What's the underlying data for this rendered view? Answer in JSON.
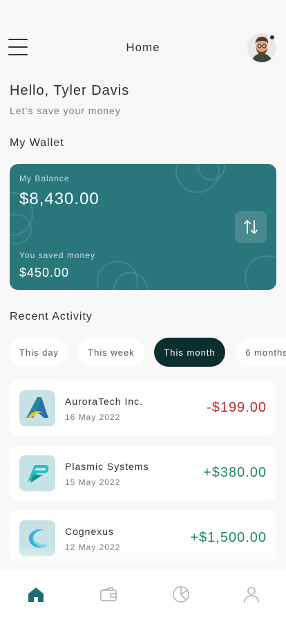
{
  "header": {
    "title": "Home",
    "menu_icon": "hamburger-menu-icon",
    "avatar_icon": "user-avatar"
  },
  "greeting": {
    "title": "Hello, Tyler Davis",
    "subtitle": "Let’s save your money"
  },
  "wallet": {
    "section_title": "My Wallet",
    "balance_label": "My Balance",
    "balance_value": "$8,430.00",
    "saved_label": "You saved money",
    "saved_value": "$450.00",
    "swap_icon": "swap-arrows-icon",
    "card_color": "#2a777b"
  },
  "activity": {
    "section_title": "Recent Activity",
    "filters": [
      {
        "label": "This day",
        "active": false
      },
      {
        "label": "This week",
        "active": false
      },
      {
        "label": "This month",
        "active": true
      },
      {
        "label": "6 months",
        "active": false
      }
    ],
    "items": [
      {
        "name": "AuroraTech Inc.",
        "date": "16 May 2022",
        "amount": "-$199.00",
        "type": "debit",
        "logo": "auroratech-logo"
      },
      {
        "name": "Plasmic Systems",
        "date": "15 May 2022",
        "amount": "+$380.00",
        "type": "credit",
        "logo": "plasmic-logo"
      },
      {
        "name": "Cognexus",
        "date": "12 May 2022",
        "amount": "+$1,500.00",
        "type": "credit",
        "logo": "cognexus-logo"
      }
    ]
  },
  "colors": {
    "accent": "#2a777b",
    "dark": "#0c2e30",
    "debit": "#c0282a",
    "credit": "#1e8c5e"
  },
  "bottom_nav": [
    {
      "icon": "home-icon",
      "active": true
    },
    {
      "icon": "wallet-icon",
      "active": false
    },
    {
      "icon": "pie-chart-icon",
      "active": false
    },
    {
      "icon": "profile-icon",
      "active": false
    }
  ]
}
